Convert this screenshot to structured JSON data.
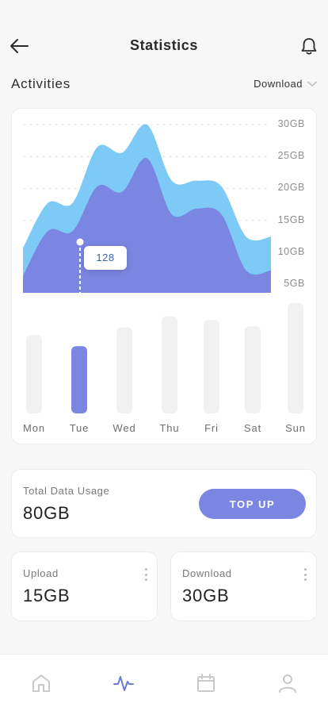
{
  "header": {
    "title": "Statistics",
    "back_icon": "arrow-left-icon",
    "bell_icon": "bell-icon"
  },
  "activities": {
    "title": "Activities",
    "dropdown_value": "Download",
    "dropdown_icon": "chevron-down-icon"
  },
  "chart_data": {
    "type": "area",
    "y_axis_ticks": [
      "30GB",
      "25GB",
      "20GB",
      "15GB",
      "10GB",
      "5GB"
    ],
    "ylim": [
      0,
      30
    ],
    "grid": true,
    "tooltip_value": "128",
    "series": [
      {
        "color": "#7ecaf6",
        "x": [
          0,
          10,
          20,
          30,
          40,
          50,
          60,
          70,
          80,
          90,
          100
        ],
        "values": [
          8,
          16,
          16,
          26,
          25,
          30,
          20,
          20,
          19,
          10,
          10
        ]
      },
      {
        "color": "#7b86e2",
        "x": [
          0,
          10,
          20,
          30,
          40,
          50,
          60,
          70,
          80,
          90,
          100
        ],
        "values": [
          3,
          11,
          11,
          19,
          18,
          24,
          14,
          15,
          14,
          4,
          4
        ]
      }
    ]
  },
  "weekly": {
    "days": [
      "Mon",
      "Tue",
      "Wed",
      "Thu",
      "Fri",
      "Sat",
      "Sun"
    ],
    "values": [
      0.71,
      0.61,
      0.78,
      0.88,
      0.85,
      0.79,
      1.0
    ],
    "selected_index": 1,
    "bar_color": "#f1f1f1",
    "selected_color": "#7b86e2"
  },
  "usage": {
    "label": "Total Data Usage",
    "value": "80GB",
    "button_label": "TOP UP"
  },
  "upload": {
    "label": "Upload",
    "value": "15GB"
  },
  "download": {
    "label": "Download",
    "value": "30GB"
  },
  "nav": {
    "items": [
      {
        "icon": "home-icon",
        "active": false
      },
      {
        "icon": "activity-icon",
        "active": true
      },
      {
        "icon": "calendar-icon",
        "active": false
      },
      {
        "icon": "user-icon",
        "active": false
      }
    ],
    "active_color": "#6d7ad6",
    "inactive_color": "#c9c9c9"
  }
}
